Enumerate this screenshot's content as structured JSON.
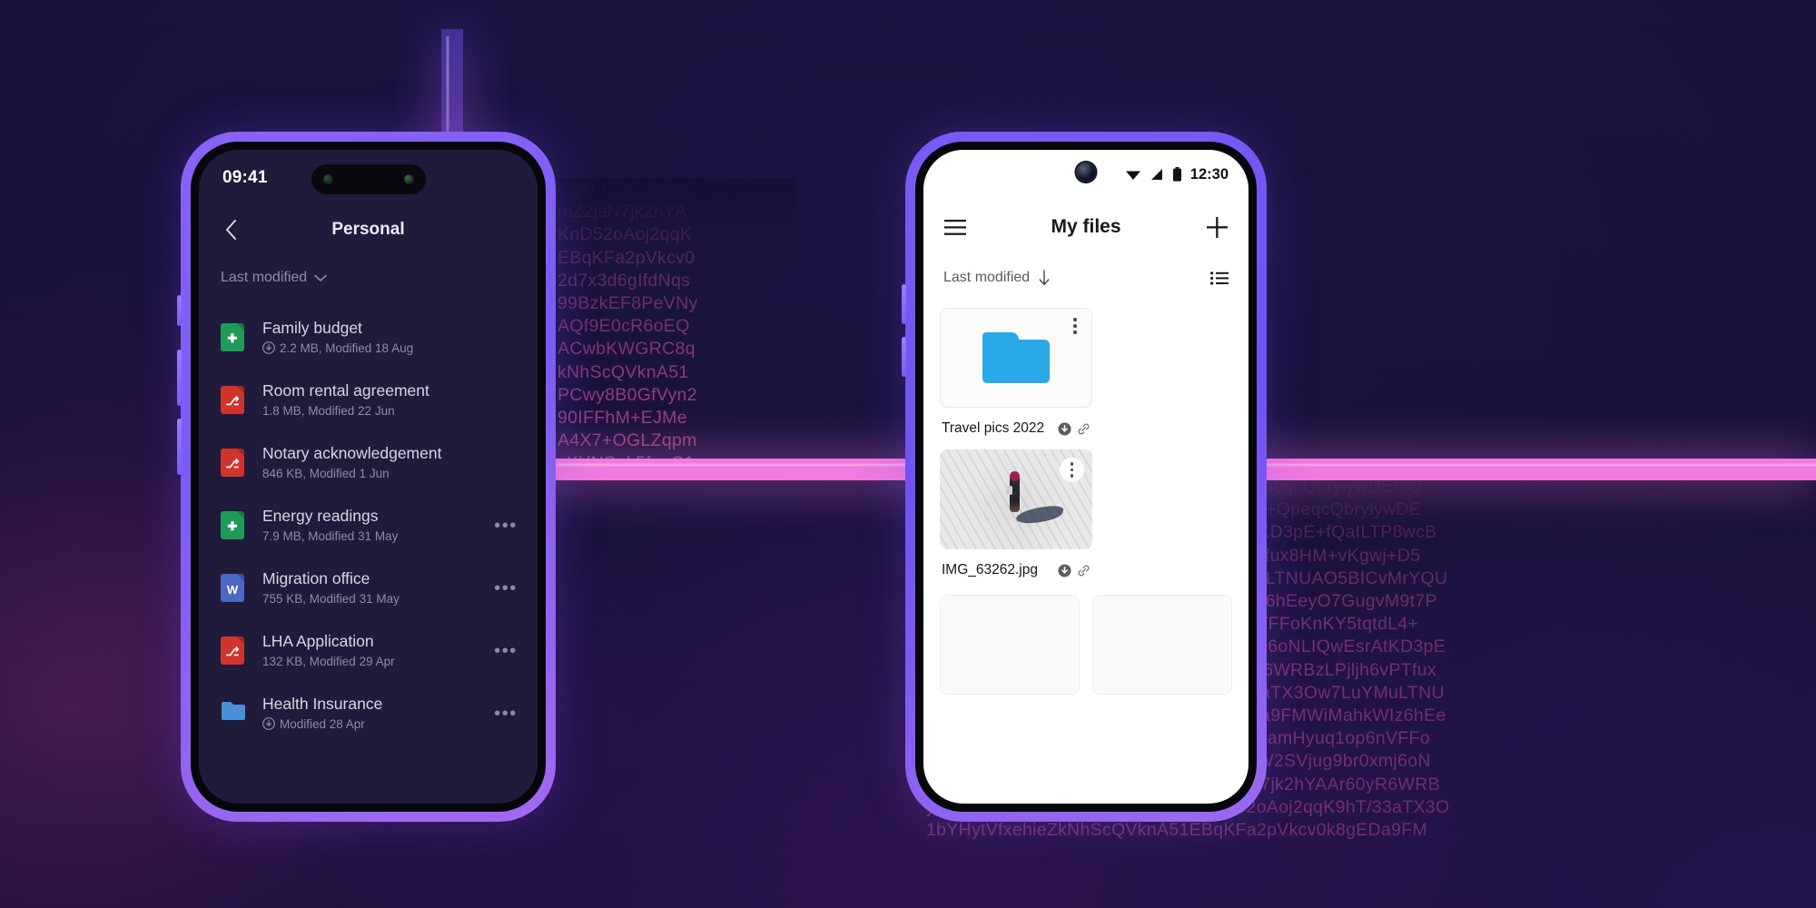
{
  "theme": {
    "bg_deep_purple": "#1c1342",
    "accent_violet": "#7b5bf5",
    "accent_pink": "#e85fae",
    "folder_blue": "#29a8e8",
    "doc_green": "#1f9b57",
    "pdf_red": "#d0342c",
    "word_blue": "#4a68c4"
  },
  "left_phone": {
    "status_bar": {
      "time": "09:41",
      "notch_icon": "dynamic-island"
    },
    "app_bar": {
      "back_icon": "chevron-left-icon",
      "title": "Personal"
    },
    "sort": {
      "label": "Last modified",
      "icon": "chevron-down-icon"
    },
    "files": [
      {
        "name": "Family budget",
        "meta": "2.2 MB, Modified 18 Aug",
        "type": "sheet",
        "color": "#1f9b57",
        "sync_icon": "download-circle-icon",
        "overflow": ""
      },
      {
        "name": "Room rental agreement",
        "meta": "1.8 MB, Modified 22 Jun",
        "type": "pdf",
        "color": "#d0342c",
        "sync_icon": "",
        "overflow": ""
      },
      {
        "name": "Notary acknowledgement",
        "meta": "846 KB, Modified 1 Jun",
        "type": "pdf",
        "color": "#d0342c",
        "sync_icon": "",
        "overflow": ""
      },
      {
        "name": "Energy readings",
        "meta": "7.9 MB, Modified 31 May",
        "type": "sheet",
        "color": "#1f9b57",
        "sync_icon": "",
        "overflow": "•••"
      },
      {
        "name": "Migration office",
        "meta": "755 KB, Modified 31 May",
        "type": "word",
        "color": "#4a68c4",
        "sync_icon": "",
        "overflow": "•••"
      },
      {
        "name": "LHA Application",
        "meta": "132 KB, Modified 29 Apr",
        "type": "pdf",
        "color": "#d0342c",
        "sync_icon": "",
        "overflow": "•••"
      },
      {
        "name": "Health Insurance",
        "meta": "Modified 28 Apr",
        "type": "folder",
        "color": "#4a90d9",
        "sync_icon": "download-circle-icon",
        "overflow": "•••"
      }
    ]
  },
  "right_phone": {
    "status_bar": {
      "time": "12:30",
      "icons": [
        "wifi-icon",
        "signal-icon",
        "battery-icon"
      ],
      "camera_icon": "punch-hole-camera-icon"
    },
    "app_bar": {
      "menu_icon": "hamburger-menu-icon",
      "title": "My files",
      "add_icon": "plus-icon"
    },
    "sort": {
      "label": "Last modified",
      "icon": "arrow-down-icon",
      "view_icon": "list-view-icon"
    },
    "grid": [
      {
        "name": "Travel pics 2022",
        "thumb": "folder",
        "kebab_icon": "kebab-menu-icon",
        "badges": [
          "download-circle-icon",
          "link-icon"
        ]
      },
      {
        "name": "IMG_63262.jpg",
        "thumb": "photo",
        "kebab_icon": "kebab-menu-icon",
        "badges": [
          "download-circle-icon",
          "link-icon"
        ]
      }
    ]
  },
  "background": {
    "cipher_upper": "+qjI17ZW2SVjuO\nmZ2jsN7jk2hYA\nKnD52oAoj2qqK\nEBqKFa2pVkcv0\n2d7x3d6gIfdNqs\n99BzkEF8PeVNy\nAQf9E0cR6oEQ\nACwbKWGRC8q\nkNhScQVknA51\nPCwy8B0GfVyn2\n90IFFhM+EJMe\nA4X7+OGLZqpm\nyKYNS+k5fguC1\n1bYHytVfxehieZ\nk3YfaY1oHQx4X\neqcQbrylywDE5\nQaILTP8wcBMA\n+vKgwj+D5Nvj\nCvMrYQUNd9tZ\nM9t7PaUAkL4+",
    "cipher_lower": "MahkWIz6hEeyO7GugvM9t7PaUAkL4+QpeqcQbrylywDE5fQ\ngFdLB4ramHyuq1op6nVFFoKnKY5tqtdL4+QpeqcQbrylywDE\nNyHi17ZW2SVjug9br0xmj6oNLIQwEsrAtKD3pE+fQaILTP8wcB\nmZ2jsN7jk2hYAAr60yR6WRBzLPjljh6vPTfux8HM+vKgwj+D5\nqKnD52oAoj2qqK9hT/33aTX3Ow7LuYMuLTNUAO5BICvMrYQU\nlEBqKFa2pVkcv0k8gEDa9FMWiMahkWIz6hEeyO7GugvM9t7P\n2d7x3d6gifdNqs6gFdLB4ramHyuq1op6nVFFoKnKY5tqtdL4+\nX99BzkEF8PeVNyHi17ZW2SVjug9br0xmj6oNLIQwEsrAtKD3pE\nmAQf9E0cR6oEQmZ2jsN7jk2hYAAr60yR6WRBzLPjljh6vPTfux\nIACwbKWGRC8qKnD52oAoj2qqK9hT/33aTX3Ow7LuYMuLTNU\nZkNhScQVknA51EBqKFa2pVkcv0k8gEDa9FMWiMahkWIz6hEe\nPCwy8B0GfVyn2d7x3d6gifdNqs6gFdLB4ramHyuq1op6nVFFo\n90IFFhM+EJMeX99BzkEF8PeVNyHi17ZW2SVjug9br0xmj6oN\nA4X7+OGLZqpmAQf9E0cR6oEQmZ2jsN7jk2hYAAr60yR6WRB\nyKYNS+k5fguC1ACwbKWGRC8qKnD52oAoj2qqK9hT/33aTX3O\n1bYHytVfxehieZkNhScQVknA51EBqKFa2pVkcv0k8gEDa9FM"
  }
}
